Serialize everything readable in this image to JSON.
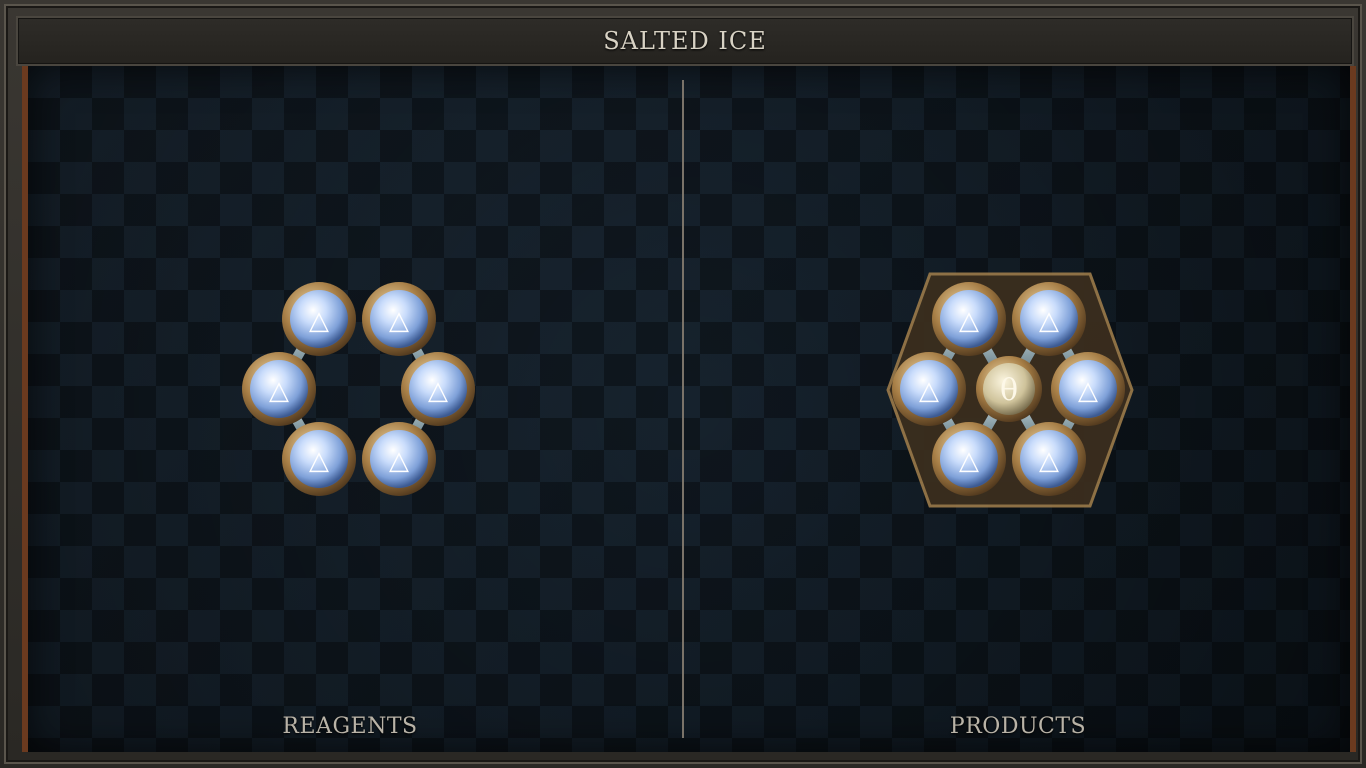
{
  "title": "SALTED ICE",
  "panels": {
    "reagents_label": "REAGENTS",
    "products_label": "PRODUCTS"
  },
  "symbols": {
    "water": "🜄",
    "salt": "θ"
  },
  "colors": {
    "board": "#15212c",
    "brass": "#b7935f",
    "orb": "#c8d8f5",
    "salt_orb": "#d9cfae"
  }
}
